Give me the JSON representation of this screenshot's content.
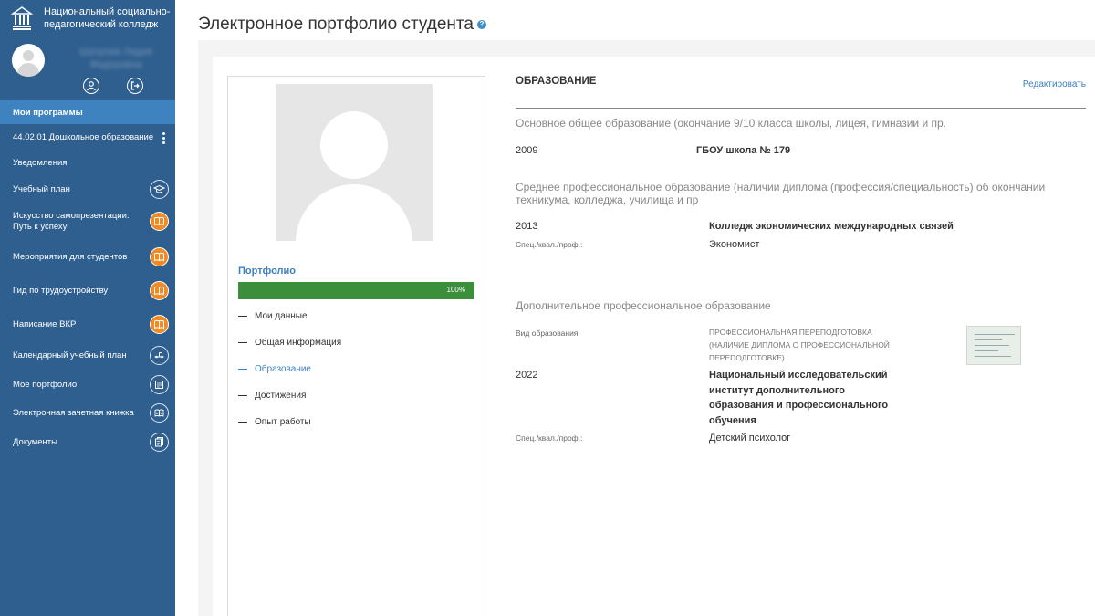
{
  "brand": {
    "name": "Национальный социально-педагогический колледж"
  },
  "user": {
    "name": "Шатрова Лидия Федоровна",
    "profile_icon": "user-icon",
    "logout_icon": "logout-icon"
  },
  "sidebar": {
    "items": [
      {
        "label": "Мои программы",
        "active": true
      },
      {
        "label": "44.02.01 Дошкольное образование"
      },
      {
        "label": "Уведомления"
      },
      {
        "label": "Учебный план",
        "icon": "graduation-cap-icon"
      },
      {
        "label": "Искусство самопрезентации. Путь к успеху",
        "icon": "book-icon"
      },
      {
        "label": "Мероприятия для студентов",
        "icon": "book-icon"
      },
      {
        "label": "Гид по трудоустройству",
        "icon": "book-icon"
      },
      {
        "label": "Написание ВКР",
        "icon": "book-icon"
      },
      {
        "label": "Календарный учебный план",
        "icon": "timeline-icon"
      },
      {
        "label": "Мое портфолио",
        "icon": "portfolio-icon"
      },
      {
        "label": "Электронная зачетная книжка",
        "icon": "record-book-icon"
      },
      {
        "label": "Документы",
        "icon": "documents-icon"
      }
    ]
  },
  "page": {
    "title": "Электронное портфолио студента",
    "help": "?"
  },
  "portfolio": {
    "title": "Портфолио",
    "progress_label": "100%",
    "progress_value": 1.0,
    "menu": [
      {
        "label": "Мои данные"
      },
      {
        "label": "Общая информация"
      },
      {
        "label": "Образование",
        "active": true
      },
      {
        "label": "Достижения"
      },
      {
        "label": "Опыт работы"
      }
    ]
  },
  "education": {
    "title": "ОБРАЗОВАНИЕ",
    "edit_label": "Редактировать",
    "basic": {
      "title": "Основное общее образование (окончание 9/10 класса школы, лицея, гимназии и пр.",
      "year": "2009",
      "institution": "ГБОУ школа № 179"
    },
    "secondary": {
      "title": "Среднее профессиональное образование (наличии диплома (профессия/специальность) об окончании техникума, колледжа, училища и пр",
      "year": "2013",
      "institution": "Колледж экономических международных связей",
      "spec_label": "Спец./квал./проф.:",
      "spec_value": "Экономист"
    },
    "additional": {
      "title": "Дополнительное профессиональное образование",
      "type_label": "Вид образования",
      "type_value": "ПРОФЕССИОНАЛЬНАЯ ПЕРЕПОДГОТОВКА (НАЛИЧИЕ ДИПЛОМА О ПРОФЕССИОНАЛЬНОЙ ПЕРЕПОДГОТОВКЕ)",
      "year": "2022",
      "institution": "Национальный исследовательский институт дополнительного образования и профессионального обучения",
      "spec_label": "Спец./квал./проф.:",
      "spec_value": "Детский психолог"
    }
  },
  "colors": {
    "sidebar": "#2f5f8f",
    "active": "#3e82c0",
    "accent": "#3e7fbf",
    "progress": "#3b8f3b",
    "badge": "#f08a24"
  }
}
